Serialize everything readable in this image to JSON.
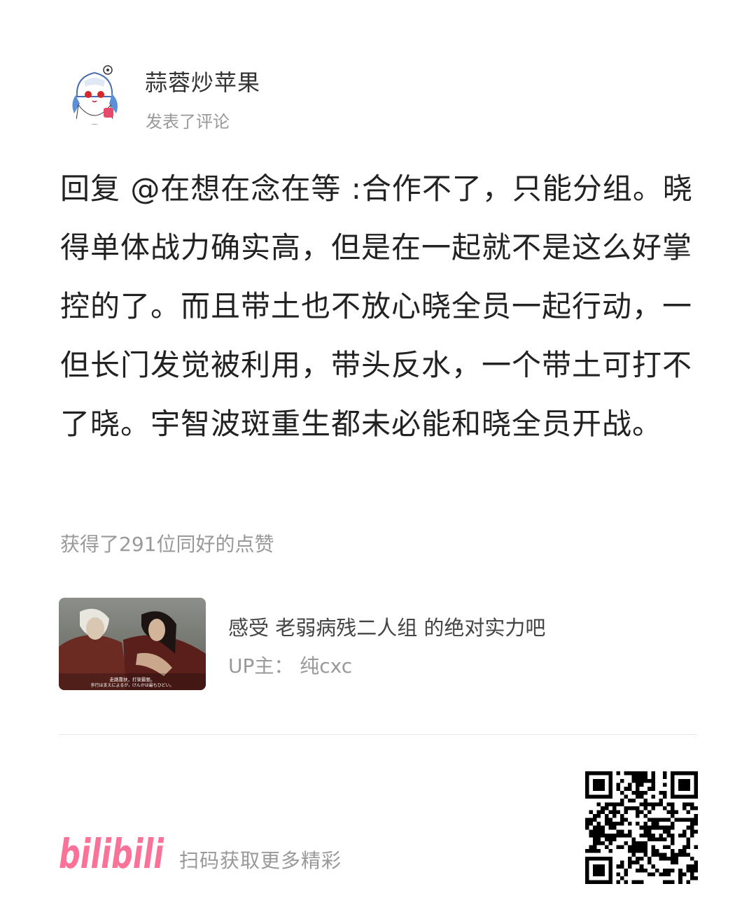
{
  "header": {
    "username": "蒜蓉炒苹果",
    "action": "发表了评论"
  },
  "comment": {
    "text": "回复 @在想在念在等 :合作不了，只能分组。晓得单体战力确实高，但是在一起就不是这么好掌控的了。而且带土也不放心晓全员一起行动，一但长门发觉被利用，带头反水，一个带土可打不了晓。宇智波斑重生都未必能和晓全员开战。",
    "likes": "获得了291位同好的点赞"
  },
  "video": {
    "title": "感受 老弱病残二人组 的绝对实力吧",
    "up": "UP主：  纯cxc",
    "subtitle_cn": "走路靠扶，打架最狠。",
    "subtitle_jp": "歩行は支えによるが，けんかは最もひどい。"
  },
  "footer": {
    "logo_text": "bilibili",
    "scan_text": "扫码获取更多精彩"
  },
  "colors": {
    "brand_pink": "#fb7299",
    "text_dark": "#222222",
    "text_muted": "#999999"
  }
}
